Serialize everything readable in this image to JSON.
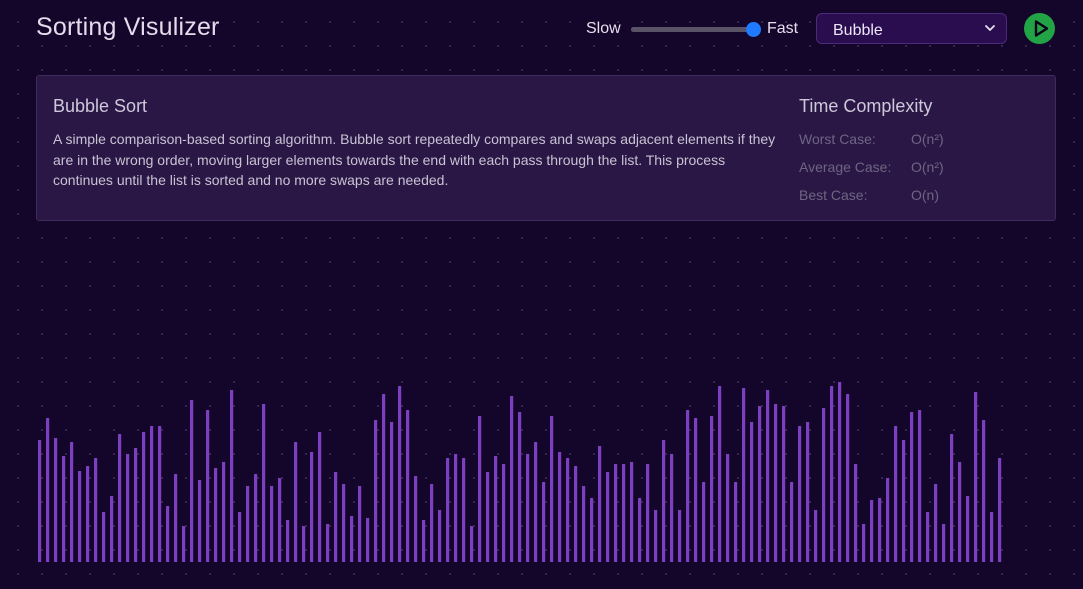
{
  "header": {
    "title": "Sorting Visulizer",
    "speed": {
      "slow_label": "Slow",
      "fast_label": "Fast",
      "level": 1.0
    },
    "algorithm_select": {
      "value": "Bubble"
    },
    "play_button": {
      "icon": "play-icon",
      "color": "#21a346"
    }
  },
  "info": {
    "name": "Bubble Sort",
    "description": "A simple comparison-based sorting algorithm. Bubble sort repeatedly compares and swaps adjacent elements if they are in the wrong order, moving larger elements towards the end with each pass through the list. This process continues until the list is sorted and no more swaps are needed.",
    "complexity_title": "Time Complexity",
    "worst_label": "Worst Case:",
    "worst_value": "O(n²)",
    "average_label": "Average Case:",
    "average_value": "O(n²)",
    "best_label": "Best Case:",
    "best_value": "O(n)"
  },
  "array": {
    "bar_color": "#7b3fbf",
    "values": [
      122,
      144,
      124,
      106,
      120,
      91,
      96,
      104,
      50,
      66,
      128,
      108,
      114,
      130,
      136,
      136,
      56,
      88,
      36,
      162,
      82,
      152,
      94,
      100,
      172,
      50,
      76,
      88,
      158,
      76,
      84,
      42,
      120,
      36,
      110,
      130,
      38,
      90,
      78,
      46,
      76,
      44,
      142,
      168,
      140,
      176,
      152,
      86,
      42,
      78,
      52,
      104,
      108,
      104,
      36,
      146,
      90,
      106,
      98,
      166,
      150,
      108,
      120,
      80,
      146,
      110,
      104,
      96,
      76,
      64,
      116,
      90,
      98,
      98,
      100,
      64,
      98,
      52,
      122,
      108,
      52,
      152,
      144,
      80,
      146,
      176,
      108,
      80,
      174,
      140,
      156,
      172,
      158,
      156,
      80,
      136,
      140,
      52,
      154,
      176,
      180,
      168,
      98,
      38,
      62,
      64,
      84,
      136,
      122,
      150,
      152,
      50,
      78,
      38,
      128,
      100,
      66,
      170,
      142,
      50,
      104
    ]
  }
}
